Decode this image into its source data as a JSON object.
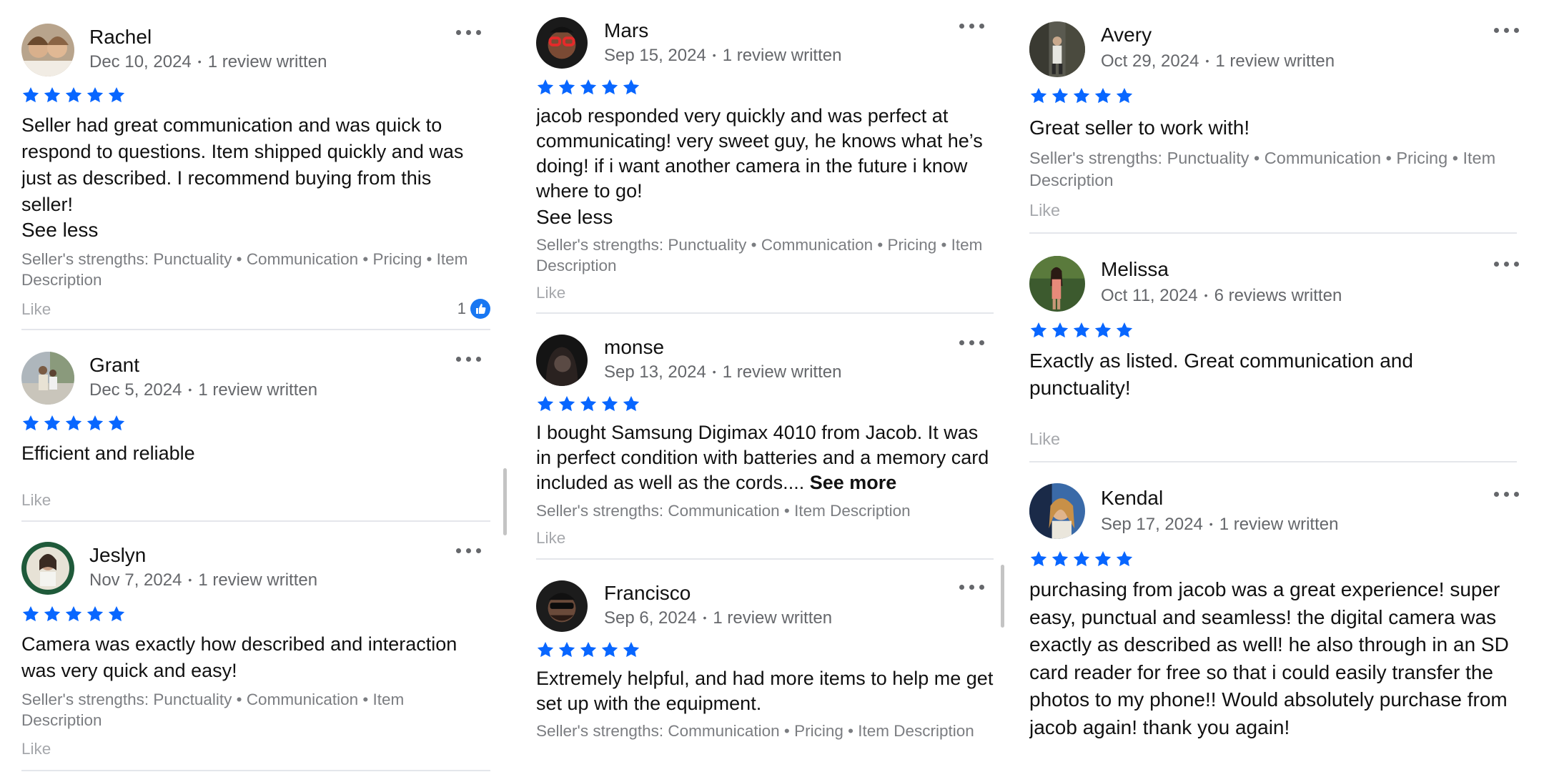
{
  "star_color": "#0866ff",
  "reviews": [
    {
      "name": "Rachel",
      "date": "Dec 10, 2024",
      "count": "1 review written",
      "text": "Seller had great communication and was quick to respond to questions. Item shipped quickly and was just as described. I recommend buying from this seller!",
      "toggle": "See less",
      "strengths": "Seller's strengths: Punctuality • Communication • Pricing • Item Description",
      "like": "Like",
      "like_count": "1"
    },
    {
      "name": "Grant",
      "date": "Dec 5, 2024",
      "count": "1 review written",
      "text": "Efficient and reliable",
      "like": "Like"
    },
    {
      "name": "Jeslyn",
      "date": "Nov 7, 2024",
      "count": "1 review written",
      "text": "Camera was exactly how described and interaction was very quick and easy!",
      "strengths": "Seller's strengths: Punctuality • Communication • Item Description",
      "like": "Like"
    },
    {
      "name": "Mars",
      "date": "Sep 15, 2024",
      "count": "1 review written",
      "text": "jacob responded very quickly and was perfect at communicating! very sweet guy, he knows what he’s doing! if i want another camera in the future i know where to go!",
      "toggle": "See less",
      "strengths": "Seller's strengths: Punctuality • Communication • Pricing • Item Description",
      "like": "Like"
    },
    {
      "name": "monse",
      "date": "Sep 13, 2024",
      "count": "1 review written",
      "text": "I bought Samsung Digimax 4010 from Jacob. It was in perfect condition with batteries and a memory card included as well as the cords....",
      "see_more": "See more",
      "strengths": "Seller's strengths: Communication • Item Description",
      "like": "Like"
    },
    {
      "name": "Francisco",
      "date": "Sep 6, 2024",
      "count": "1 review written",
      "text": "Extremely helpful, and had more items to help me get set up with the equipment.",
      "strengths": "Seller's strengths: Communication • Pricing • Item Description"
    },
    {
      "name": "Avery",
      "date": "Oct 29, 2024",
      "count": "1 review written",
      "text": "Great seller to work with!",
      "strengths": "Seller's strengths: Punctuality • Communication • Pricing • Item Description",
      "like": "Like"
    },
    {
      "name": "Melissa",
      "date": "Oct 11, 2024",
      "count": "6 reviews written",
      "text": "Exactly as listed. Great communication and punctuality!",
      "like": "Like"
    },
    {
      "name": "Kendal",
      "date": "Sep 17, 2024",
      "count": "1 review written",
      "text": "purchasing from jacob was a great experience! super easy, punctual and seamless! the digital camera was exactly as described as well! he also through in an SD card reader for free so that i could easily transfer the photos to my phone!! Would absolutely purchase from jacob again! thank you again!"
    }
  ]
}
